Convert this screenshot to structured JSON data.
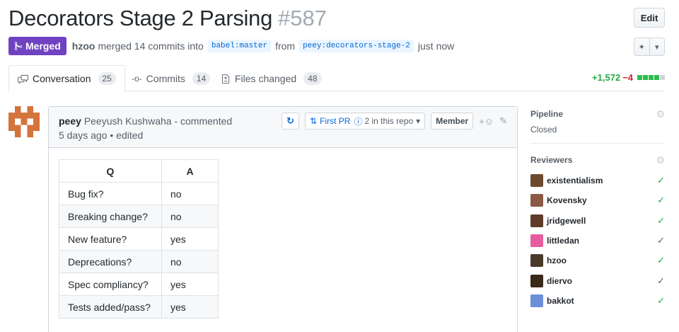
{
  "header": {
    "title": "Decorators Stage 2 Parsing",
    "number": "#587",
    "edit_label": "Edit"
  },
  "meta": {
    "state_label": "Merged",
    "author": "hzoo",
    "text_merged": "merged 14 commits into",
    "base_branch": "babel:master",
    "text_from": "from",
    "head_branch": "peey:decorators-stage-2",
    "time": "just now"
  },
  "tabs": [
    {
      "label": "Conversation",
      "count": "25"
    },
    {
      "label": "Commits",
      "count": "14"
    },
    {
      "label": "Files changed",
      "count": "48"
    }
  ],
  "diffstat": {
    "additions": "+1,572",
    "deletions": "−4"
  },
  "comment": {
    "author_login": "peey",
    "author_name": "Peeyush Kushwaha",
    "action": "- commented",
    "time": "5 days ago",
    "edited": "• edited",
    "first_pr_label": "First PR",
    "repo_count": "2 in this repo",
    "member_label": "Member",
    "table_headers": [
      "Q",
      "A"
    ],
    "table_rows": [
      [
        "Bug fix?",
        "no"
      ],
      [
        "Breaking change?",
        "no"
      ],
      [
        "New feature?",
        "yes"
      ],
      [
        "Deprecations?",
        "no"
      ],
      [
        "Spec compliancy?",
        "yes"
      ],
      [
        "Tests added/pass?",
        "yes"
      ]
    ]
  },
  "sidebar": {
    "pipeline_label": "Pipeline",
    "pipeline_value": "Closed",
    "reviewers_label": "Reviewers",
    "reviewers": [
      {
        "name": "existentialism",
        "approved": true
      },
      {
        "name": "Kovensky",
        "approved": true
      },
      {
        "name": "jridgewell",
        "approved": true
      },
      {
        "name": "littledan",
        "approved": false
      },
      {
        "name": "hzoo",
        "approved": true
      },
      {
        "name": "diervo",
        "approved": false
      },
      {
        "name": "bakkot",
        "approved": true
      }
    ]
  },
  "colors": {
    "merged": "#6f42c1",
    "addition": "#28a745",
    "deletion": "#cb2431",
    "link": "#0366d6"
  }
}
